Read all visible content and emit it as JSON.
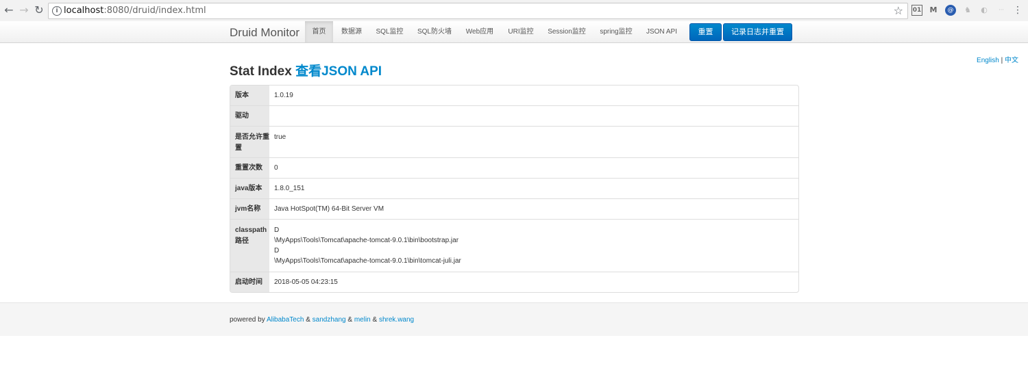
{
  "browser": {
    "url_host": "localhost",
    "url_path": ":8080/druid/index.html",
    "extensions": [
      "01",
      "M",
      "@",
      "♞",
      "◐",
      "···"
    ]
  },
  "navbar": {
    "brand": "Druid Monitor",
    "items": [
      {
        "label": "首页",
        "active": true
      },
      {
        "label": "数据源"
      },
      {
        "label": "SQL监控"
      },
      {
        "label": "SQL防火墙"
      },
      {
        "label": "Web应用"
      },
      {
        "label": "URI监控"
      },
      {
        "label": "Session监控"
      },
      {
        "label": "spring监控"
      },
      {
        "label": "JSON API"
      }
    ],
    "reset_label": "重置",
    "log_reset_label": "记录日志并重置"
  },
  "lang": {
    "english": "English",
    "sep": " | ",
    "chinese": "中文"
  },
  "page": {
    "title": "Stat Index ",
    "json_link": "查看JSON API"
  },
  "stats": [
    {
      "key": "版本",
      "value": "1.0.19"
    },
    {
      "key": "驱动",
      "value": ""
    },
    {
      "key": "是否允许重置",
      "value": "true"
    },
    {
      "key": "重置次数",
      "value": "0"
    },
    {
      "key": "java版本",
      "value": "1.8.0_151"
    },
    {
      "key": "jvm名称",
      "value": "Java HotSpot(TM) 64-Bit Server VM"
    },
    {
      "key": "classpath路径",
      "lines": [
        "D",
        "\\MyApps\\Tools\\Tomcat\\apache-tomcat-9.0.1\\bin\\bootstrap.jar",
        "D",
        "\\MyApps\\Tools\\Tomcat\\apache-tomcat-9.0.1\\bin\\tomcat-juli.jar"
      ]
    },
    {
      "key": "启动时间",
      "value": "2018-05-05 04:23:15"
    }
  ],
  "footer": {
    "prefix": "powered by ",
    "authors": [
      "AlibabaTech",
      "sandzhang",
      "melin",
      "shrek.wang"
    ],
    "joiner": " & "
  }
}
